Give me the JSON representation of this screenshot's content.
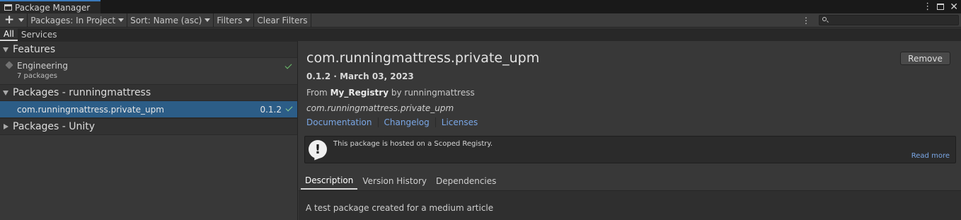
{
  "window": {
    "title": "Package Manager"
  },
  "toolbar": {
    "add_icon": "plus-icon",
    "packages_label": "Packages: In Project",
    "sort_label": "Sort: Name (asc)",
    "filters_label": "Filters",
    "clear_filters_label": "Clear Filters",
    "search_placeholder": ""
  },
  "scope_tabs": [
    {
      "label": "All",
      "active": true
    },
    {
      "label": "Services",
      "active": false
    }
  ],
  "left": {
    "groups": [
      {
        "title": "Features",
        "expanded": true
      },
      {
        "title": "Packages - runningmattress",
        "expanded": true
      },
      {
        "title": "Packages - Unity",
        "expanded": false
      }
    ],
    "feature": {
      "name": "Engineering",
      "sub": "7 packages",
      "installed": true
    },
    "package": {
      "name": "com.runningmattress.private_upm",
      "version": "0.1.2",
      "installed": true
    }
  },
  "detail": {
    "title": "com.runningmattress.private_upm",
    "remove_label": "Remove",
    "version_line": "0.1.2 · March 03, 2023",
    "from_prefix": "From",
    "registry": "My_Registry",
    "by_text": "by runningmattress",
    "package_id": "com.runningmattress.private_upm",
    "links": [
      "Documentation",
      "Changelog",
      "Licenses"
    ],
    "notice": {
      "text": "This package is hosted on a Scoped Registry.",
      "read_more": "Read more"
    },
    "tabs": [
      {
        "label": "Description",
        "active": true
      },
      {
        "label": "Version History",
        "active": false
      },
      {
        "label": "Dependencies",
        "active": false
      }
    ],
    "description": "A test package created for a medium article"
  },
  "colors": {
    "accent": "#3a79bb",
    "selection": "#2c5d87",
    "link": "#7aa7e6",
    "check": "#6dc26d"
  }
}
